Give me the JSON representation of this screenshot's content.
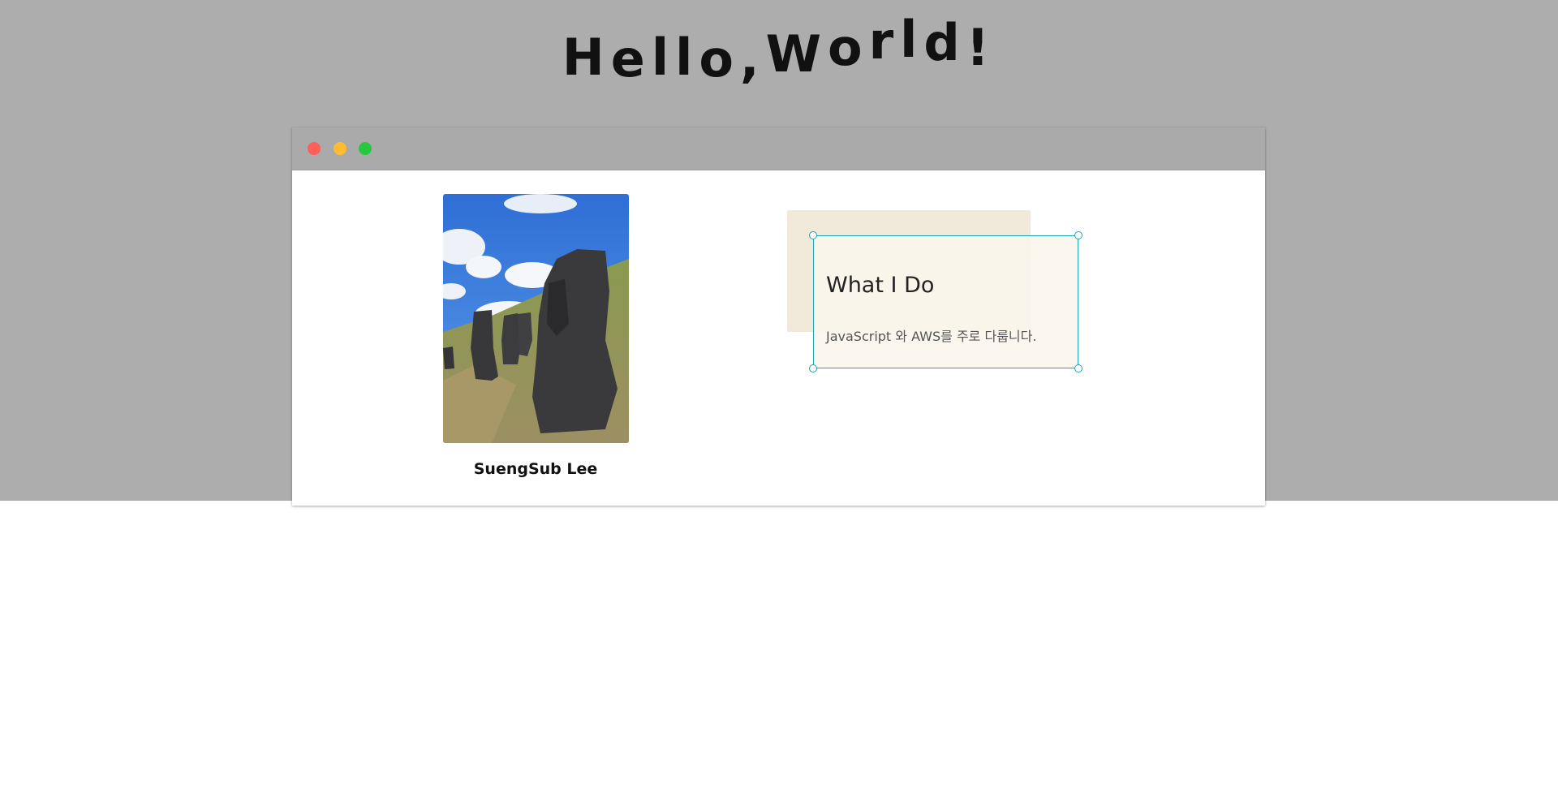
{
  "headline": {
    "letters": [
      "H",
      "e",
      "l",
      "l",
      "o",
      ",",
      "W",
      "o",
      "r",
      "l",
      "d",
      "!"
    ]
  },
  "window": {
    "traffic_lights": {
      "close_color": "#fe5f57",
      "minimize_color": "#febc2e",
      "maximize_color": "#27c840"
    }
  },
  "profile": {
    "name": "SuengSub Lee",
    "photo_icon": "moai-statues-photo"
  },
  "card": {
    "title": "What I Do",
    "description": "JavaScript 와 AWS를 주로 다룹니다.",
    "accent_color": "#1aa6b7",
    "shadow_color": "#f1eadb"
  },
  "colors": {
    "hero_background": "#adadad",
    "page_background": "#ffffff"
  }
}
